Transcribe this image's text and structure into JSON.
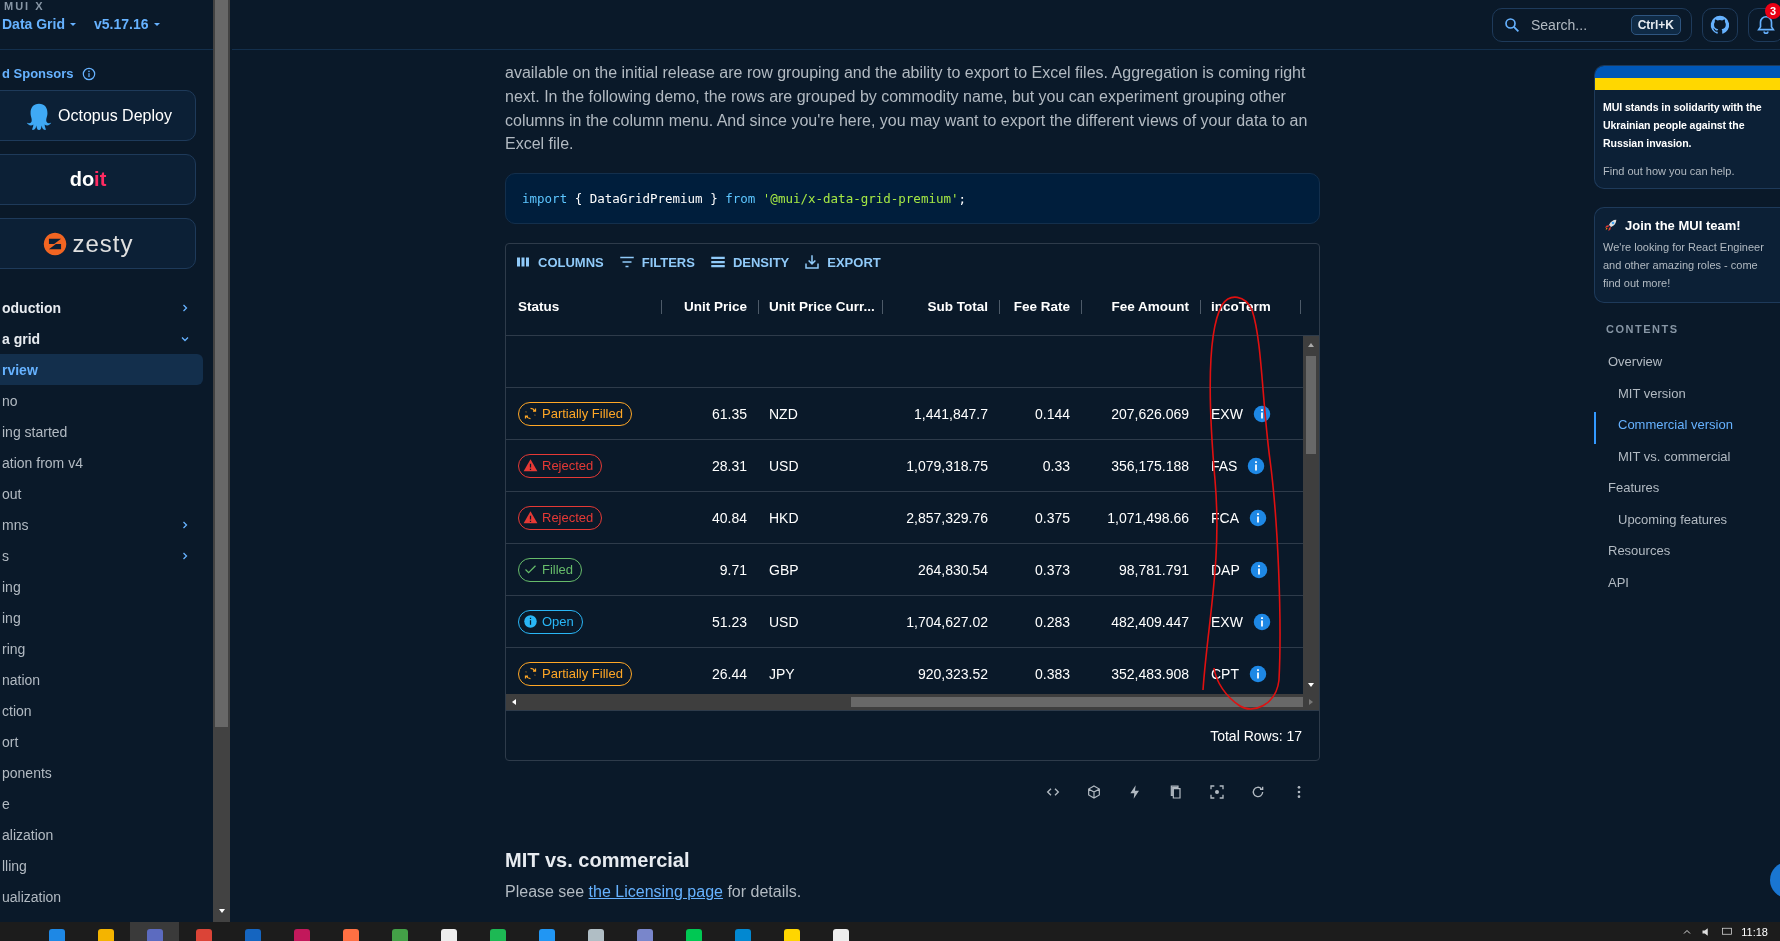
{
  "sidebar": {
    "product_label": "MUI X",
    "product": "Data Grid",
    "version": "v5.17.16",
    "sponsors_heading": "d Sponsors",
    "sponsors": [
      {
        "kind": "octopus",
        "text": "Octopus Deploy"
      },
      {
        "kind": "doit",
        "text": "do",
        "accent": "it"
      },
      {
        "kind": "zesty",
        "text": "zesty"
      }
    ],
    "nav": [
      {
        "label": "oduction",
        "kind": "section",
        "expanded": false,
        "selected": false
      },
      {
        "label": "a grid",
        "kind": "section",
        "expanded": true,
        "selected": false
      },
      {
        "label": "rview",
        "kind": "page",
        "selected": true
      },
      {
        "label": "no",
        "kind": "page",
        "selected": false
      },
      {
        "label": "ing started",
        "kind": "page",
        "selected": false
      },
      {
        "label": "ation from v4",
        "kind": "page",
        "selected": false
      },
      {
        "label": "out",
        "kind": "page",
        "selected": false
      },
      {
        "label": "mns",
        "kind": "group",
        "expanded": false,
        "selected": false
      },
      {
        "label": "s",
        "kind": "group",
        "expanded": false,
        "selected": false
      },
      {
        "label": "ing",
        "kind": "page",
        "selected": false
      },
      {
        "label": "ing",
        "kind": "page",
        "selected": false
      },
      {
        "label": "ring",
        "kind": "page",
        "selected": false
      },
      {
        "label": "nation",
        "kind": "page",
        "selected": false
      },
      {
        "label": "ction",
        "kind": "page",
        "selected": false
      },
      {
        "label": "ort",
        "kind": "page",
        "selected": false
      },
      {
        "label": "ponents",
        "kind": "page",
        "selected": false
      },
      {
        "label": "e",
        "kind": "page",
        "selected": false
      },
      {
        "label": "alization",
        "kind": "page",
        "selected": false
      },
      {
        "label": "lling",
        "kind": "page",
        "selected": false
      },
      {
        "label": "ualization",
        "kind": "page",
        "selected": false
      }
    ]
  },
  "header": {
    "search": {
      "placeholder": "Search...",
      "shortcut": "Ctrl+K"
    },
    "notifications": "3"
  },
  "content": {
    "paragraph": "available on the initial release are row grouping and the ability to export to Excel files. Aggregation is coming right next. In the following demo, the rows are grouped by commodity name, but you can experiment grouping other columns in the column menu. And since you're here, you may want to export the different views of your data to an Excel file.",
    "code": [
      {
        "kind": "keyword",
        "text": "import"
      },
      {
        "kind": "plain",
        "text": " { DataGridPremium } "
      },
      {
        "kind": "keyword",
        "text": "from "
      },
      {
        "kind": "string",
        "text": "'@mui/x-data-grid-premium'"
      },
      {
        "kind": "plain",
        "text": ";"
      }
    ],
    "grid": {
      "toolbar": [
        {
          "kind": "columns",
          "label": "COLUMNS"
        },
        {
          "kind": "filters",
          "label": "FILTERS"
        },
        {
          "kind": "density",
          "label": "DENSITY"
        },
        {
          "kind": "export",
          "label": "EXPORT"
        }
      ],
      "columns": [
        "Status",
        "Unit Price",
        "Unit Price Curr...",
        "Sub Total",
        "Fee Rate",
        "Fee Amount",
        "incoTerm"
      ],
      "rows": [
        {
          "kind": "partial",
          "cells": [
            "Partially Filled",
            "61.35",
            "NZD",
            "1,441,847.7",
            "0.144",
            "207,626.069",
            "EXW"
          ]
        },
        {
          "kind": "rejected",
          "cells": [
            "Rejected",
            "28.31",
            "USD",
            "1,079,318.75",
            "0.33",
            "356,175.188",
            "FAS"
          ]
        },
        {
          "kind": "rejected",
          "cells": [
            "Rejected",
            "40.84",
            "HKD",
            "2,857,329.76",
            "0.375",
            "1,071,498.66",
            "FCA"
          ]
        },
        {
          "kind": "filled",
          "cells": [
            "Filled",
            "9.71",
            "GBP",
            "264,830.54",
            "0.373",
            "98,781.791",
            "DAP"
          ]
        },
        {
          "kind": "open",
          "cells": [
            "Open",
            "51.23",
            "USD",
            "1,704,627.02",
            "0.283",
            "482,409.447",
            "EXW"
          ]
        },
        {
          "kind": "partial",
          "cells": [
            "Partially Filled",
            "26.44",
            "JPY",
            "920,323.52",
            "0.383",
            "352,483.908",
            "CPT"
          ]
        }
      ],
      "footer": "Total Rows: 17"
    },
    "section": {
      "heading": "MIT vs. commercial",
      "before": "Please see ",
      "link": "the Licensing page",
      "after": " for details."
    }
  },
  "aside": {
    "ukraine": {
      "lines": [
        "MUI stands in solidarity with the",
        "Ukrainian people against the",
        "Russian invasion."
      ],
      "link": "Find out how you can help."
    },
    "join": {
      "title": "Join the MUI team!",
      "lines": [
        "We're looking for React Engineer",
        "and other amazing roles - come",
        "find out more!"
      ]
    },
    "contents_heading": "CONTENTS",
    "toc": [
      {
        "label": "Overview",
        "selected": false,
        "children": [
          {
            "label": "MIT version",
            "selected": false
          },
          {
            "label": "Commercial version",
            "selected": true
          },
          {
            "label": "MIT vs. commercial",
            "selected": false
          }
        ]
      },
      {
        "label": "Features",
        "selected": false,
        "children": [
          {
            "label": "Upcoming features",
            "selected": false
          }
        ]
      },
      {
        "label": "Resources",
        "selected": false
      },
      {
        "label": "API",
        "selected": false
      }
    ]
  },
  "taskbar": {
    "apps": [
      {
        "selected": false
      },
      {
        "selected": false
      },
      {
        "selected": true
      },
      {
        "selected": false
      },
      {
        "selected": false
      },
      {
        "selected": false
      },
      {
        "selected": false
      },
      {
        "selected": false
      },
      {
        "selected": false
      },
      {
        "selected": false
      },
      {
        "selected": false
      },
      {
        "selected": false
      },
      {
        "selected": false
      },
      {
        "selected": false
      },
      {
        "selected": false
      },
      {
        "selected": false
      },
      {
        "selected": false
      }
    ],
    "clock": "11:18"
  }
}
